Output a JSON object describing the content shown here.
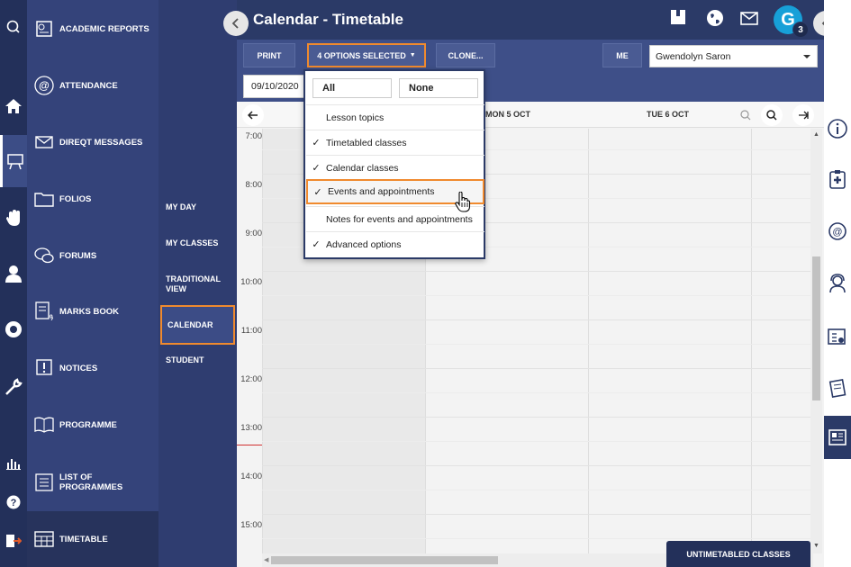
{
  "header": {
    "title": "Calendar - Timetable",
    "avatar_letter": "G",
    "badge_count": "3"
  },
  "nav": {
    "items": [
      {
        "label": "ACADEMIC REPORTS",
        "icon": "report-icon"
      },
      {
        "label": "ATTENDANCE",
        "icon": "at-icon"
      },
      {
        "label": "DIREQT MESSAGES",
        "icon": "envelope-icon"
      },
      {
        "label": "FOLIOS",
        "icon": "folder-icon"
      },
      {
        "label": "FORUMS",
        "icon": "chat-icon"
      },
      {
        "label": "MARKS BOOK",
        "icon": "marks-icon"
      },
      {
        "label": "NOTICES",
        "icon": "notice-icon"
      },
      {
        "label": "PROGRAMME",
        "icon": "book-icon"
      },
      {
        "label": "LIST OF PROGRAMMES",
        "icon": "list-icon"
      },
      {
        "label": "TIMETABLE",
        "icon": "timetable-icon"
      }
    ]
  },
  "subnav": {
    "items": [
      {
        "label": "MY DAY"
      },
      {
        "label": "MY CLASSES"
      },
      {
        "label": "TRADITIONAL VIEW"
      },
      {
        "label": "CALENDAR"
      },
      {
        "label": "STUDENT"
      }
    ]
  },
  "toolbar": {
    "print": "PRINT",
    "options": "4 OPTIONS SELECTED",
    "clone": "CLONE...",
    "me": "ME",
    "person": "Gwendolyn Saron",
    "date": "09/10/2020"
  },
  "calendar": {
    "days": [
      "MON 5 OCT",
      "TUE 6 OCT"
    ],
    "times": [
      "7:00",
      "8:00",
      "9:00",
      "10:00",
      "11:00",
      "12:00",
      "13:00",
      "14:00",
      "15:00"
    ],
    "untimetabled": "UNTIMETABLED CLASSES"
  },
  "dropdown": {
    "all": "All",
    "none": "None",
    "options": [
      {
        "label": "Lesson topics",
        "checked": false
      },
      {
        "label": "Timetabled classes",
        "checked": true
      },
      {
        "label": "Calendar classes",
        "checked": true
      },
      {
        "label": "Events and appointments",
        "checked": true
      },
      {
        "label": "Notes for events and appointments",
        "checked": false
      },
      {
        "label": "Advanced options",
        "checked": true
      }
    ]
  },
  "colors": {
    "accent": "#f08a2e",
    "primary": "#2b3a67",
    "avatar": "#17a0d8"
  }
}
